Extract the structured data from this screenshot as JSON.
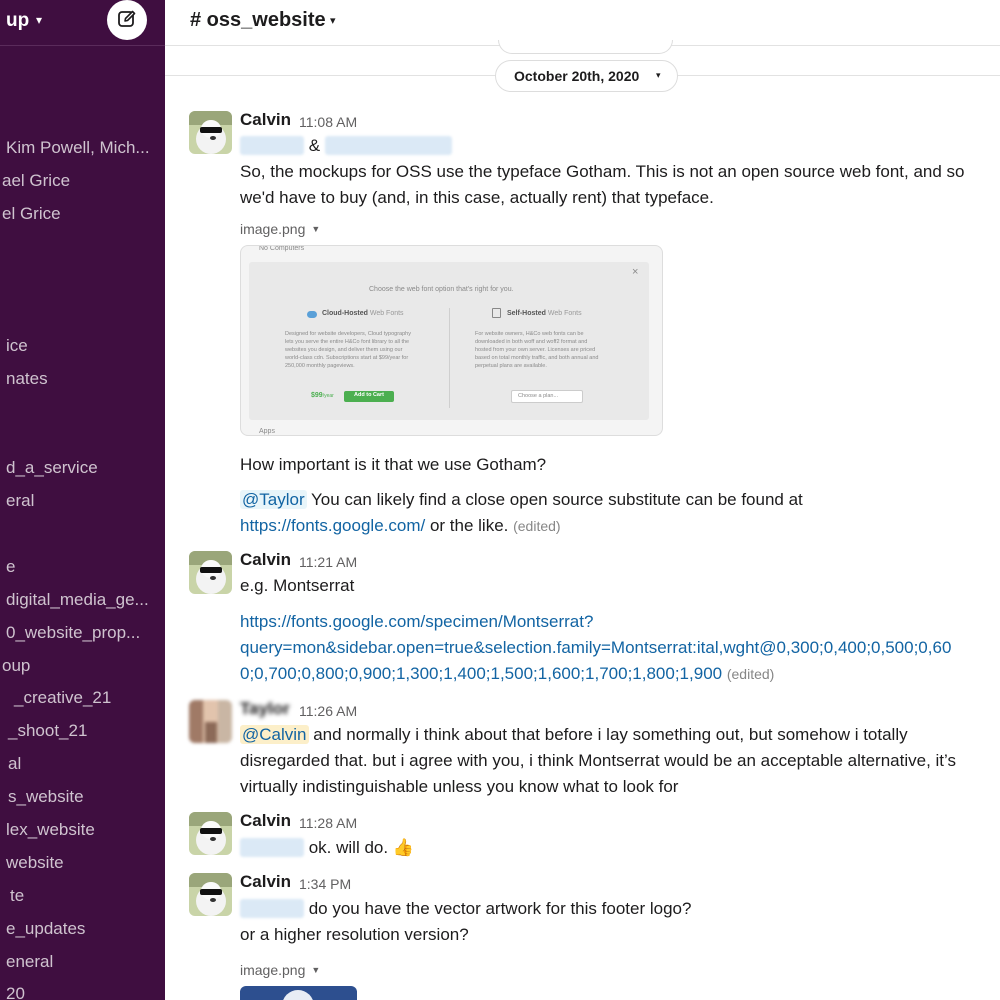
{
  "sidebar": {
    "workspace_name": "up",
    "chevron_icon": "chevron-down-icon",
    "compose_icon": "compose-icon",
    "items": [
      {
        "label": "Kim Powell, Mich..."
      },
      {
        "label": "ael Grice"
      },
      {
        "label": "el Grice"
      },
      {
        "label": "ice"
      },
      {
        "label": "nates"
      },
      {
        "label": "d_a_service"
      },
      {
        "label": "eral"
      },
      {
        "label": "e"
      },
      {
        "label": "digital_media_ge..."
      },
      {
        "label": "0_website_prop..."
      },
      {
        "label": "oup"
      },
      {
        "label": "_creative_21"
      },
      {
        "label": "_shoot_21"
      },
      {
        "label": "al"
      },
      {
        "label": "s_website"
      },
      {
        "label": "lex_website"
      },
      {
        "label": "website"
      },
      {
        "label": "te"
      },
      {
        "label": "e_updates"
      },
      {
        "label": "eneral"
      },
      {
        "label": "20"
      }
    ]
  },
  "channel": {
    "title": "# oss_website",
    "chevron_icon": "chevron-down-icon"
  },
  "date_divider": {
    "label": "October 20th, 2020"
  },
  "messages": [
    {
      "author": "Calvin",
      "time": "11:08 AM",
      "amp": "&",
      "line1": "So, the mockups for OSS use the typeface Gotham. This is not an open source web font, and so",
      "line2": "we'd have to buy (and, in this case, actually rent) that typeface.",
      "file_label": "image.png",
      "preview": {
        "top_text": "No Computers",
        "heading": "Choose the web font option that's right for you.",
        "left_title": "Cloud-Hosted",
        "left_title_suffix": "Web Fonts",
        "left_body": [
          "Designed for website developers, Cloud typography",
          "lets you serve the entire H&Co font library to all the",
          "websites you design, and deliver them using our",
          "world-class cdn. Subscriptions start at $99/year for",
          "250,000 monthly pageviews."
        ],
        "price": "$99",
        "price_suffix": "/year",
        "cart_button": "Add to Cart",
        "right_title": "Self-Hosted",
        "right_title_suffix": "Web Fonts",
        "right_body": [
          "For website owners, H&Co web fonts can be",
          "downloaded in both woff and woff2 format and",
          "hosted from your own server. Licenses are priced",
          "based on total monthly traffic, and both annual and",
          "perpetual plans are available."
        ],
        "plan_select": "Choose a plan...",
        "bottom_text": "Apps",
        "close": "×"
      },
      "line3": "How important is it that we use Gotham?",
      "mention": "@Taylor",
      "line4_rest": " You can likely find a close open source substitute can be found at",
      "link": "https://fonts.google.com/",
      "line5_rest": " or the like.",
      "edited": "(edited)"
    },
    {
      "author": "Calvin",
      "time": "11:21 AM",
      "line1": "e.g. Montserrat",
      "link1": "https://fonts.google.com/specimen/Montserrat?",
      "link2": "query=mon&sidebar.open=true&selection.family=Montserrat:ital,wght@0,300;0,400;0,500;0,60",
      "link3": "0;0,700;0,800;0,900;1,300;1,400;1,500;1,600;1,700;1,800;1,900",
      "edited": "(edited)"
    },
    {
      "author": "Taylor",
      "time": "11:26 AM",
      "mention": "@Calvin",
      "line1_rest": " and normally i think about that before i lay something out, but somehow i totally",
      "line2": "disregarded that. but i agree with you, i think Montserrat would be an acceptable alternative, it’s",
      "line3": "virtually indistinguishable unless you know what to look for"
    },
    {
      "author": "Calvin",
      "time": "11:28 AM",
      "line1_rest": " ok. will do.",
      "emoji": "👍"
    },
    {
      "author": "Calvin",
      "time": "1:34 PM",
      "line1_rest": " do you have the vector artwork for this footer logo?",
      "line2": "or a higher resolution version?",
      "file_label": "image.png"
    }
  ],
  "colors": {
    "sidebar_bg": "#3f0e40",
    "link": "#1264a3",
    "mention_bg": "#e8f5fa",
    "self_mention_bg": "#fcefc9",
    "add_to_cart": "#4caf50"
  }
}
